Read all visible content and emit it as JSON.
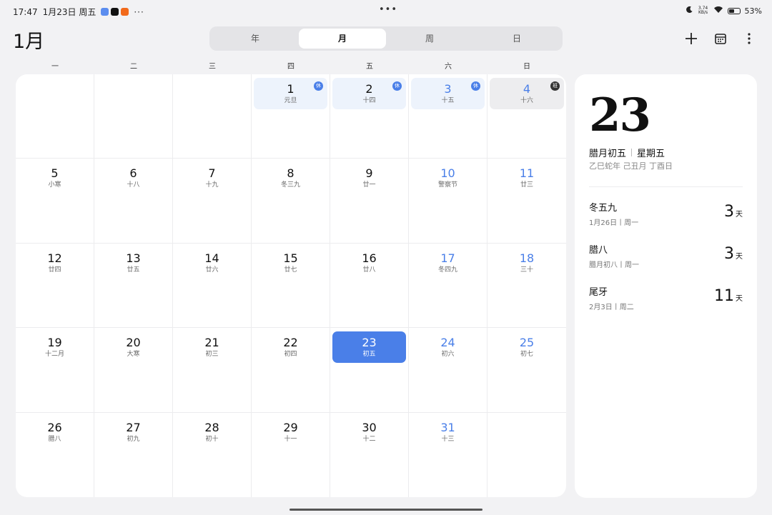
{
  "status_bar": {
    "time": "17:47",
    "date": "1月23日 周五",
    "more_dots": "···",
    "center_dots": "•••",
    "net_speed": "3.74",
    "net_unit": "KB/s",
    "battery": "53%",
    "battery_level": 0.53
  },
  "header": {
    "month_title": "1月",
    "view_tabs": [
      {
        "label": "年"
      },
      {
        "label": "月"
      },
      {
        "label": "周"
      },
      {
        "label": "日"
      }
    ],
    "active_tab": "月"
  },
  "weekdays": [
    "一",
    "二",
    "三",
    "四",
    "五",
    "六",
    "日"
  ],
  "calendar": {
    "weeks": [
      [
        {
          "num": "",
          "lunar": ""
        },
        {
          "num": "",
          "lunar": ""
        },
        {
          "num": "",
          "lunar": ""
        },
        {
          "num": "1",
          "lunar": "元旦",
          "badge": "休",
          "style": "holiday"
        },
        {
          "num": "2",
          "lunar": "十四",
          "badge": "休",
          "style": "holiday"
        },
        {
          "num": "3",
          "lunar": "十五",
          "badge": "休",
          "style": "holiday"
        },
        {
          "num": "4",
          "lunar": "十六",
          "badge": "班",
          "style": "workday"
        }
      ],
      [
        {
          "num": "5",
          "lunar": "小寒"
        },
        {
          "num": "6",
          "lunar": "十八"
        },
        {
          "num": "7",
          "lunar": "十九"
        },
        {
          "num": "8",
          "lunar": "冬三九"
        },
        {
          "num": "9",
          "lunar": "廿一"
        },
        {
          "num": "10",
          "lunar": "警察节"
        },
        {
          "num": "11",
          "lunar": "廿三"
        }
      ],
      [
        {
          "num": "12",
          "lunar": "廿四"
        },
        {
          "num": "13",
          "lunar": "廿五"
        },
        {
          "num": "14",
          "lunar": "廿六"
        },
        {
          "num": "15",
          "lunar": "廿七"
        },
        {
          "num": "16",
          "lunar": "廿八"
        },
        {
          "num": "17",
          "lunar": "冬四九"
        },
        {
          "num": "18",
          "lunar": "三十"
        }
      ],
      [
        {
          "num": "19",
          "lunar": "十二月"
        },
        {
          "num": "20",
          "lunar": "大寒"
        },
        {
          "num": "21",
          "lunar": "初三"
        },
        {
          "num": "22",
          "lunar": "初四"
        },
        {
          "num": "23",
          "lunar": "初五",
          "style": "today"
        },
        {
          "num": "24",
          "lunar": "初六"
        },
        {
          "num": "25",
          "lunar": "初七"
        }
      ],
      [
        {
          "num": "26",
          "lunar": "腊八"
        },
        {
          "num": "27",
          "lunar": "初九"
        },
        {
          "num": "28",
          "lunar": "初十"
        },
        {
          "num": "29",
          "lunar": "十一"
        },
        {
          "num": "30",
          "lunar": "十二"
        },
        {
          "num": "31",
          "lunar": "十三"
        },
        {
          "num": "",
          "lunar": ""
        }
      ]
    ]
  },
  "side_panel": {
    "big_date": "23",
    "lunar_date": "腊月初五",
    "weekday": "星期五",
    "ganzhi": "乙巳蛇年 己丑月 丁酉日",
    "events": [
      {
        "title": "冬五九",
        "sub": "1月26日丨周一",
        "count": "3",
        "unit": "天"
      },
      {
        "title": "腊八",
        "sub": "腊月初八丨周一",
        "count": "3",
        "unit": "天"
      },
      {
        "title": "尾牙",
        "sub": "2月3日丨周二",
        "count": "11",
        "unit": "天"
      }
    ]
  },
  "colors": {
    "accent": "#4a7fe8",
    "holiday_bg": "#edf3fc",
    "workday_badge": "#333333"
  }
}
